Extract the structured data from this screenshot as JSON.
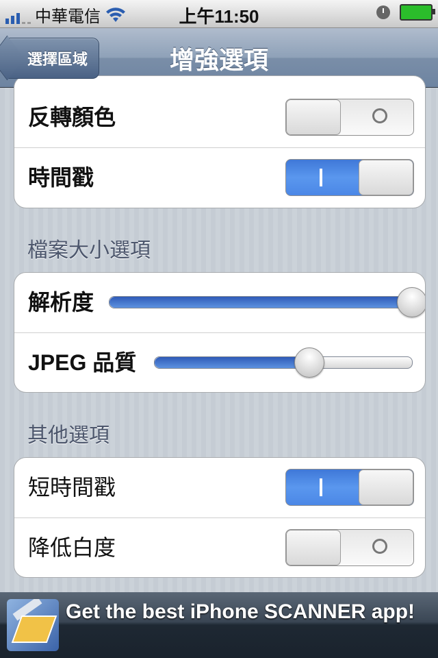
{
  "status_bar": {
    "carrier": "中華電信",
    "time": "上午11:50"
  },
  "nav": {
    "back_label": "選擇區域",
    "title": "增強選項"
  },
  "group1": {
    "rows": [
      {
        "label": "反轉顏色",
        "switch_on": false
      },
      {
        "label": "時間戳",
        "switch_on": true
      }
    ]
  },
  "section2": {
    "header": "檔案大小選項",
    "rows": [
      {
        "label": "解析度",
        "slider_value": 1.0
      },
      {
        "label": "JPEG 品質",
        "slider_value": 0.6
      }
    ]
  },
  "section3": {
    "header": "其他選項",
    "rows": [
      {
        "label": "短時間戳",
        "switch_on": true
      },
      {
        "label": "降低白度",
        "switch_on": false
      }
    ]
  },
  "ad": {
    "text": "Get the best iPhone SCANNER app!"
  },
  "colors": {
    "switch_on": "#4b87e6",
    "nav_bar": "#8ea1b8",
    "background": "#c5ccd4"
  },
  "icons": [
    "signal-icon",
    "wifi-icon",
    "clock-icon",
    "battery-icon",
    "scanner-app-icon"
  ]
}
